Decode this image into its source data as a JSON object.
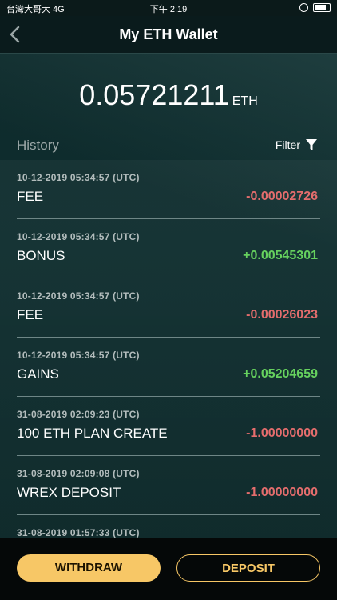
{
  "status_bar": {
    "carrier": "台灣大哥大 4G",
    "time": "下午 2:19"
  },
  "header": {
    "title": "My ETH Wallet"
  },
  "balance": {
    "amount": "0.05721211",
    "unit": "ETH"
  },
  "history": {
    "title": "History",
    "filter_label": "Filter"
  },
  "transactions": [
    {
      "timestamp": "10-12-2019 05:34:57 (UTC)",
      "type": "FEE",
      "amount": "-0.00002726",
      "direction": "negative"
    },
    {
      "timestamp": "10-12-2019 05:34:57 (UTC)",
      "type": "BONUS",
      "amount": "+0.00545301",
      "direction": "positive"
    },
    {
      "timestamp": "10-12-2019 05:34:57 (UTC)",
      "type": "FEE",
      "amount": "-0.00026023",
      "direction": "negative"
    },
    {
      "timestamp": "10-12-2019 05:34:57 (UTC)",
      "type": "GAINS",
      "amount": "+0.05204659",
      "direction": "positive"
    },
    {
      "timestamp": "31-08-2019 02:09:23 (UTC)",
      "type": "100 ETH PLAN CREATE",
      "amount": "-1.00000000",
      "direction": "negative"
    },
    {
      "timestamp": "31-08-2019 02:09:08 (UTC)",
      "type": "WREX DEPOSIT",
      "amount": "-1.00000000",
      "direction": "negative"
    },
    {
      "timestamp": "31-08-2019 01:57:33 (UTC)",
      "type": "",
      "amount": "",
      "direction": "negative"
    }
  ],
  "actions": {
    "withdraw_label": "WITHDRAW",
    "deposit_label": "DEPOSIT"
  },
  "colors": {
    "accent": "#f7c766",
    "positive": "#66d15e",
    "negative": "#e46d6d"
  },
  "icons": {
    "back": "chevron-left-icon",
    "filter": "funnel-icon",
    "battery": "battery-icon",
    "alarm": "alarm-icon"
  }
}
